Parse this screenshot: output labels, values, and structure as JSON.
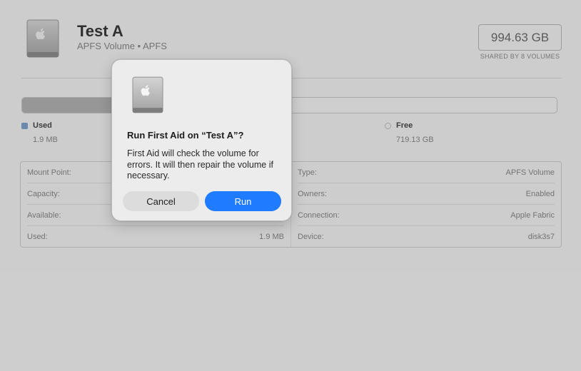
{
  "volume": {
    "title": "Test A",
    "subtitle": "APFS Volume • APFS",
    "capacity": "994.63 GB",
    "capacity_caption": "SHARED BY 8 VOLUMES",
    "icon": "hard-drive-icon"
  },
  "usage": {
    "used_fraction": 0.17,
    "legend": [
      {
        "label": "Used",
        "value": "1.9 MB",
        "color": "#7ea4cf"
      },
      {
        "label": "Free",
        "value": "719.13 GB",
        "color": "#c0c0c0"
      }
    ]
  },
  "info": {
    "left": [
      {
        "key": "Mount Point:",
        "value": ""
      },
      {
        "key": "Capacity:",
        "value": ""
      },
      {
        "key": "Available:",
        "value": ""
      },
      {
        "key": "Used:",
        "value": "1.9 MB"
      }
    ],
    "right": [
      {
        "key": "Type:",
        "value": "APFS Volume"
      },
      {
        "key": "Owners:",
        "value": "Enabled"
      },
      {
        "key": "Connection:",
        "value": "Apple Fabric"
      },
      {
        "key": "Device:",
        "value": "disk3s7"
      }
    ]
  },
  "dialog": {
    "title": "Run First Aid on “Test A”?",
    "message": "First Aid will check the volume for errors. It will then repair the volume if necessary.",
    "cancel_label": "Cancel",
    "run_label": "Run",
    "accent": "#1f7bff",
    "icon": "hard-drive-icon"
  }
}
